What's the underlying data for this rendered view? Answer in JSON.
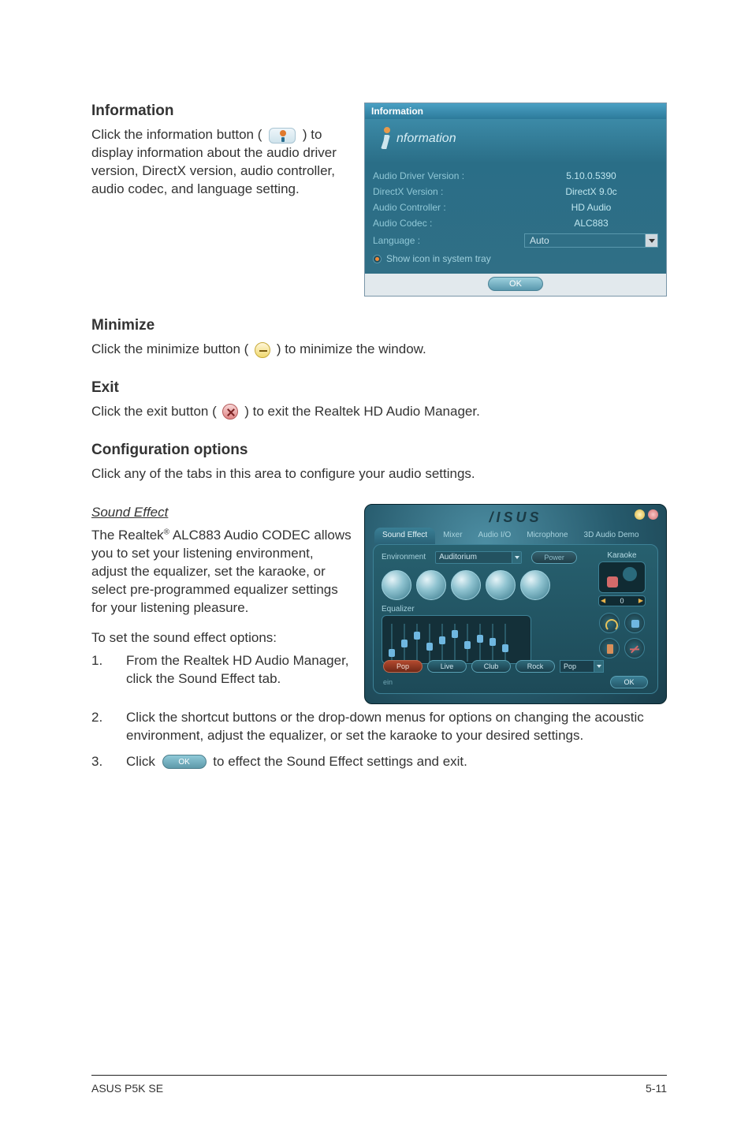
{
  "sections": {
    "information": {
      "heading": "Information",
      "body_pre": "Click the information button ( ",
      "body_post": " ) to display information about the audio driver version, DirectX version, audio controller, audio codec, and language setting."
    },
    "minimize": {
      "heading": "Minimize",
      "body_pre": "Click the minimize button (",
      "body_post": ") to minimize the window."
    },
    "exit": {
      "heading": "Exit",
      "body_pre": "Click the exit button (",
      "body_post": ") to exit the Realtek HD Audio Manager."
    },
    "config": {
      "heading": "Configuration options",
      "body": "Click any of the tabs in this area to configure your audio settings."
    },
    "sound_effect": {
      "subheading": "Sound Effect",
      "body_pre": "The Realtek",
      "body_sup": "®",
      "body_post": " ALC883 Audio CODEC allows you to set your listening environment, adjust the equalizer, set the karaoke, or select pre-programmed equalizer settings for your listening pleasure.",
      "intro": "To set the sound effect options:",
      "steps": [
        "From the Realtek HD Audio Manager, click the Sound Effect tab.",
        "Click the shortcut buttons or the drop-down menus for options on changing the acoustic environment, adjust the equalizer, or set the karaoke to your desired settings."
      ],
      "step3_pre": "Click ",
      "step3_post": " to effect the Sound Effect settings and exit."
    }
  },
  "info_dialog": {
    "title": "Information",
    "header": "nformation",
    "rows": {
      "driver_label": "Audio Driver Version :",
      "driver_value": "5.10.0.5390",
      "directx_label": "DirectX Version :",
      "directx_value": "DirectX 9.0c",
      "ctrl_label": "Audio Controller :",
      "ctrl_value": "HD Audio",
      "codec_label": "Audio Codec :",
      "codec_value": "ALC883",
      "lang_label": "Language :",
      "lang_value": "Auto",
      "tray_label": "Show icon in system tray"
    },
    "ok": "OK"
  },
  "asus_panel": {
    "brand": "/ISUS",
    "tabs": [
      "Sound Effect",
      "Mixer",
      "Audio I/O",
      "Microphone",
      "3D Audio Demo"
    ],
    "env_label": "Environment",
    "env_value": "Auditorium",
    "power_btn": "Power",
    "karaoke_label": "Karaoke",
    "karaoke_value": "0",
    "eq_label": "Equalizer",
    "presets": [
      "Pop",
      "Live",
      "Club",
      "Rock"
    ],
    "preset_dropdown": "Pop",
    "footer_note": "ein",
    "ok": "OK"
  },
  "inline_ok": "OK",
  "footer": {
    "left": "ASUS P5K SE",
    "right": "5-11"
  }
}
